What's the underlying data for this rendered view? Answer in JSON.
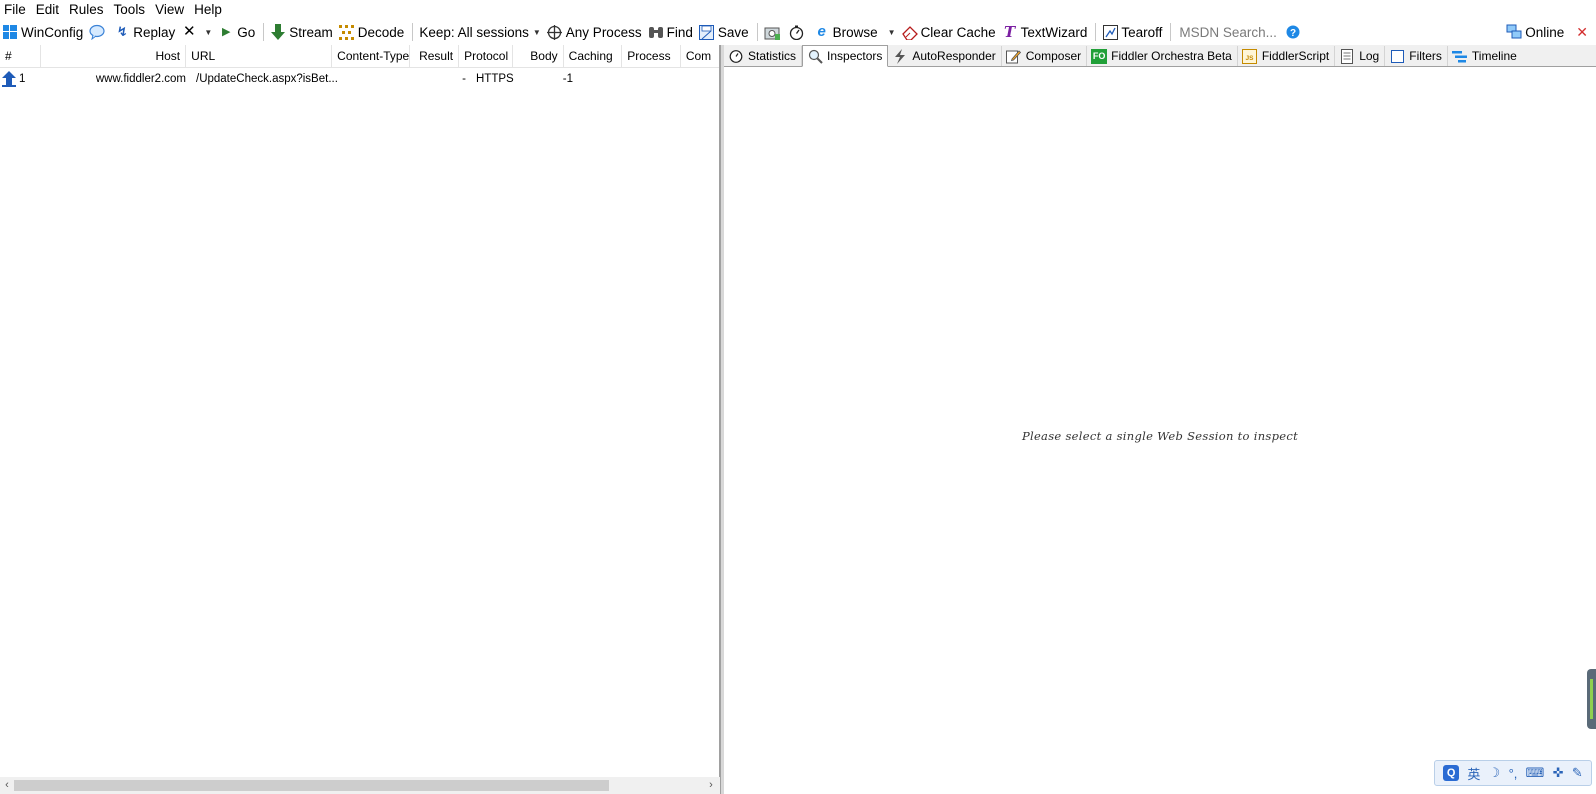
{
  "menu": [
    "File",
    "Edit",
    "Rules",
    "Tools",
    "View",
    "Help"
  ],
  "toolbar": {
    "winconfig": "WinConfig",
    "replay": "Replay",
    "go": "Go",
    "stream": "Stream",
    "decode": "Decode",
    "keep": "Keep: All sessions",
    "any_process": "Any Process",
    "find": "Find",
    "save": "Save",
    "browse": "Browse",
    "clear_cache": "Clear Cache",
    "textwizard": "TextWizard",
    "tearoff": "Tearoff",
    "search_placeholder": "MSDN Search...",
    "online": "Online"
  },
  "columns": [
    "#",
    "Host",
    "URL",
    "Content-Type",
    "Result",
    "Protocol",
    "Body",
    "Caching",
    "Process",
    "Com"
  ],
  "sessions": [
    {
      "id": "1",
      "host": "www.fiddler2.com",
      "url": "/UpdateCheck.aspx?isBet...",
      "content_type": "",
      "result": "-",
      "protocol": "HTTPS",
      "body": "-1",
      "caching": "",
      "process": ""
    }
  ],
  "tabs": [
    "Statistics",
    "Inspectors",
    "AutoResponder",
    "Composer",
    "Fiddler Orchestra Beta",
    "FiddlerScript",
    "Log",
    "Filters",
    "Timeline"
  ],
  "active_tab": "Inspectors",
  "inspector_message": "Please select a single Web Session to inspect",
  "ime": {
    "lang": "英",
    "logo": "Q"
  },
  "colors": {
    "accent_blue": "#1e5bb8",
    "stream_green": "#2e7d32",
    "fo_green": "#21a038",
    "textwizard_purple": "#7b1fa2",
    "close_red": "#d32f2f"
  }
}
